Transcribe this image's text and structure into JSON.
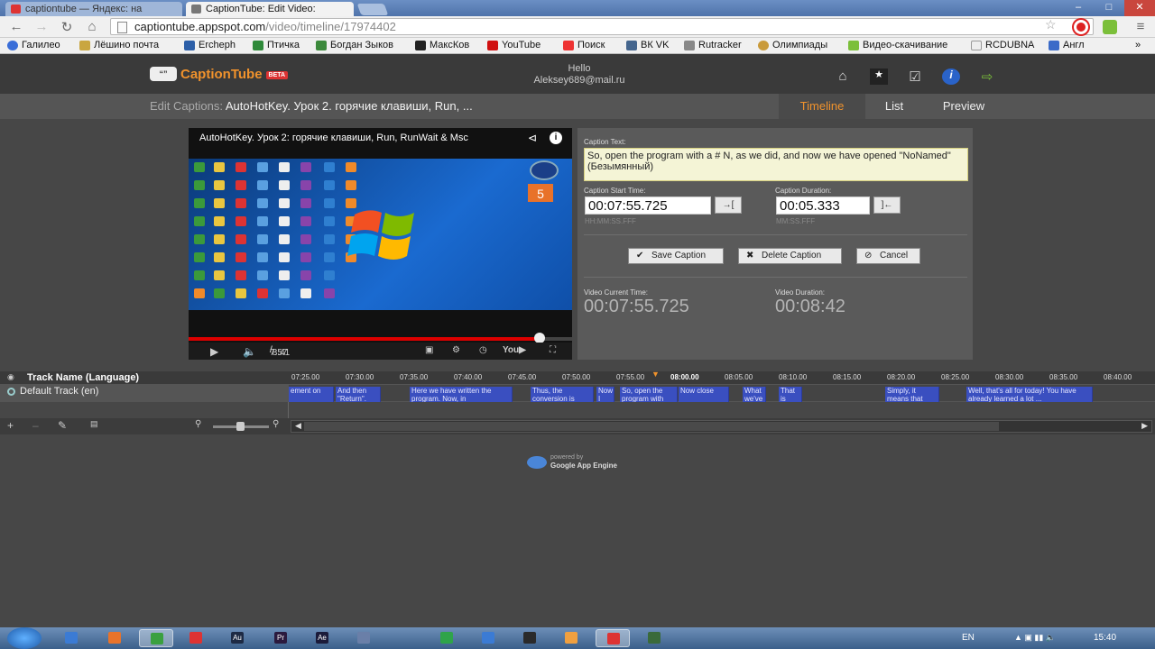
{
  "browser": {
    "tabs": [
      {
        "title": "captiontube — Яндекс: на"
      },
      {
        "title": "CaptionTube: Edit Video:"
      }
    ],
    "url_host": "captiontube.appspot.com",
    "url_path": "/video/timeline/17974402",
    "bookmarks": [
      "Галилео",
      "Лёшино почта",
      "Ercheph",
      "Птичка",
      "Богдан Зыков",
      "МаксКов",
      "YouTube",
      "Поиск",
      "ВК VK",
      "Rutracker",
      "Олимпиады",
      "Видео-скачивание",
      "RCDUBNA",
      "Англ"
    ]
  },
  "app": {
    "logo": "CaptionTube",
    "beta": "BETA",
    "hello": "Hello",
    "user": "Aleksey689@mail.ru",
    "edit_label": "Edit Captions:",
    "video_name": "AutoHotKey. Урок 2. горячие клавиши, Run, ...",
    "view_tabs": [
      "Timeline",
      "List",
      "Preview"
    ]
  },
  "video": {
    "title": "AutoHotKey. Урок 2: горячие клавиши, Run, RunWait & Msc",
    "current": "7:57",
    "duration": "8:41",
    "progress": 0.915,
    "calendar_day": "5"
  },
  "editor": {
    "caption_text_label": "Caption Text:",
    "caption_text": "So, open the program with a # N, as we did, and now we have opened \"NoNamed\" (Безымянный)",
    "start_label": "Caption Start Time:",
    "start_value": "00:07:55.725",
    "start_hint": "HH:MM:SS.FFF",
    "duration_label": "Caption Duration:",
    "duration_value": "00:05.333",
    "duration_hint": "MM:SS.FFF",
    "save": "Save Caption",
    "delete": "Delete Caption",
    "cancel": "Cancel",
    "current_time_label": "Video Current Time:",
    "current_time": "00:07:55.725",
    "video_duration_label": "Video Duration:",
    "video_duration": "00:08:42"
  },
  "timeline": {
    "track_header": "Track Name (Language)",
    "track_name": "Default Track (en)",
    "ticks": [
      "07:25.00",
      "07:30.00",
      "07:35.00",
      "07:40.00",
      "07:45.00",
      "07:50.00",
      "07:55.00",
      "08:00.00",
      "08:05.00",
      "08:10.00",
      "08:15.00",
      "08:20.00",
      "08:25.00",
      "08:30.00",
      "08:35.00",
      "08:40.00"
    ],
    "current_tick": "08:00.00",
    "captions": [
      {
        "text": "ement on"
      },
      {
        "text": "And then \"Return\"."
      },
      {
        "text": "Here we have written the program. Now, in"
      },
      {
        "text": "Thus, the conversion is"
      },
      {
        "text": "Now I"
      },
      {
        "text": "So, open the program with the"
      },
      {
        "text": "Now close"
      },
      {
        "text": "What we've"
      },
      {
        "text": "That is"
      },
      {
        "text": "Simply, it means that"
      },
      {
        "text": "Well, that's all for today! You have already learned a lot ..."
      }
    ]
  },
  "footer": {
    "powered": "powered by",
    "engine": "Google App Engine"
  },
  "taskbar": {
    "lang": "EN",
    "clock": "15:40"
  }
}
